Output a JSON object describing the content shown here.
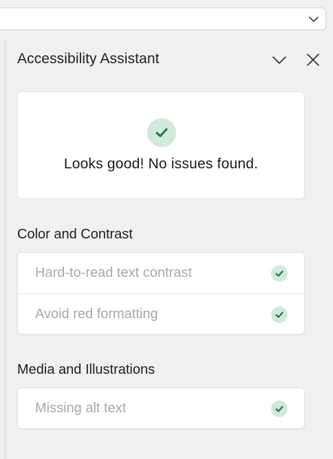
{
  "pane": {
    "title": "Accessibility Assistant",
    "collapse_icon": "chevron-down-icon",
    "close_icon": "close-icon"
  },
  "top_dropdown": {
    "value": "",
    "icon": "chevron-down-icon"
  },
  "summary": {
    "icon": "check-circle-icon",
    "message": "Looks good! No issues found."
  },
  "sections": [
    {
      "heading": "Color and Contrast",
      "items": [
        {
          "label": "Hard-to-read text contrast",
          "status_icon": "check-circle-icon"
        },
        {
          "label": "Avoid red formatting",
          "status_icon": "check-circle-icon"
        }
      ]
    },
    {
      "heading": "Media and Illustrations",
      "items": [
        {
          "label": "Missing alt text",
          "status_icon": "check-circle-icon"
        }
      ]
    }
  ],
  "colors": {
    "check_green": "#1d7a45",
    "check_bg": "#cfeadb",
    "muted_text": "#a8a8a8",
    "pane_bg": "#f0f0f0"
  }
}
